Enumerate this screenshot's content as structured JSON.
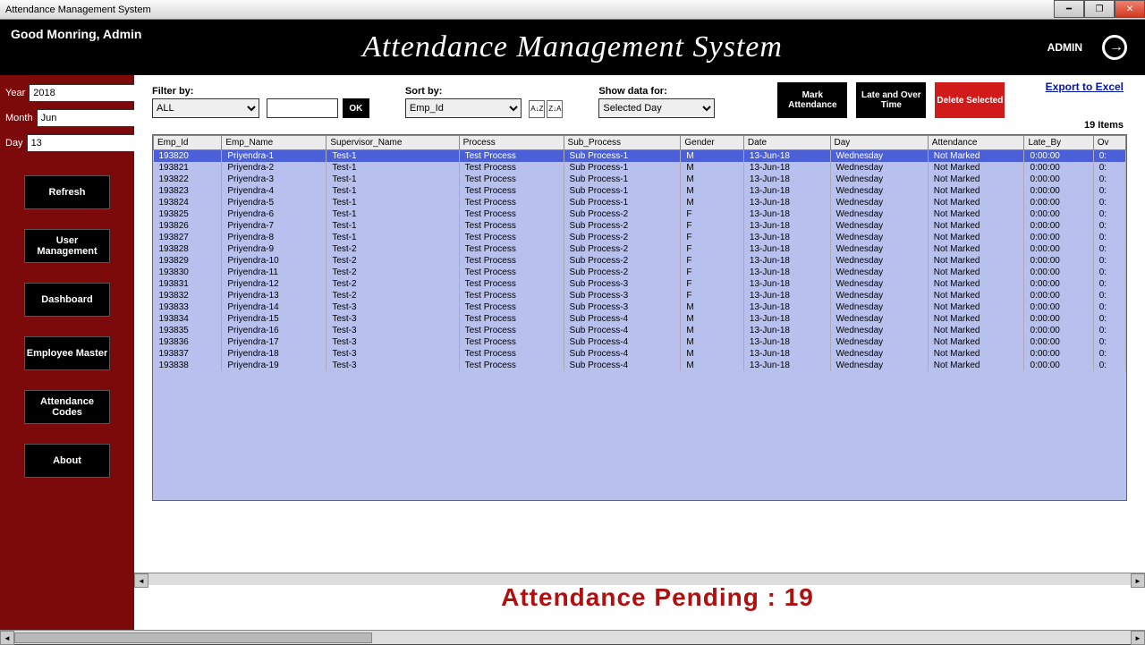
{
  "window_title": "Attendance Management System",
  "header": {
    "greeting": "Good Monring, Admin",
    "title": "Attendance Management System",
    "user_role": "ADMIN"
  },
  "sidebar": {
    "year_label": "Year",
    "year_value": "2018",
    "month_label": "Month",
    "month_value": "Jun",
    "day_label": "Day",
    "day_value": "13",
    "buttons": [
      "Refresh",
      "User Management",
      "Dashboard",
      "Employee Master",
      "Attendance Codes",
      "About"
    ]
  },
  "toolbar": {
    "filter_label": "Filter by:",
    "filter_value": "ALL",
    "filter_text": "",
    "ok": "OK",
    "sort_label": "Sort by:",
    "sort_value": "Emp_Id",
    "show_label": "Show data for:",
    "show_value": "Selected Day",
    "mark": "Mark Attendance",
    "late": "Late and Over Time",
    "delete": "Delete Selected",
    "export": "Export to Excel",
    "items_count": "19 Items"
  },
  "columns": [
    "Emp_Id",
    "Emp_Name",
    "Supervisor_Name",
    "Process",
    "Sub_Process",
    "Gender",
    "Date",
    "Day",
    "Attendance",
    "Late_By",
    "Ov"
  ],
  "rows": [
    {
      "id": "193820",
      "name": "Priyendra-1",
      "sup": "Test-1",
      "proc": "Test Process",
      "sub": "Sub Process-1",
      "g": "M",
      "date": "13-Jun-18",
      "day": "Wednesday",
      "att": "Not Marked",
      "late": "0:00:00",
      "ov": "0:"
    },
    {
      "id": "193821",
      "name": "Priyendra-2",
      "sup": "Test-1",
      "proc": "Test Process",
      "sub": "Sub Process-1",
      "g": "M",
      "date": "13-Jun-18",
      "day": "Wednesday",
      "att": "Not Marked",
      "late": "0:00:00",
      "ov": "0:"
    },
    {
      "id": "193822",
      "name": "Priyendra-3",
      "sup": "Test-1",
      "proc": "Test Process",
      "sub": "Sub Process-1",
      "g": "M",
      "date": "13-Jun-18",
      "day": "Wednesday",
      "att": "Not Marked",
      "late": "0:00:00",
      "ov": "0:"
    },
    {
      "id": "193823",
      "name": "Priyendra-4",
      "sup": "Test-1",
      "proc": "Test Process",
      "sub": "Sub Process-1",
      "g": "M",
      "date": "13-Jun-18",
      "day": "Wednesday",
      "att": "Not Marked",
      "late": "0:00:00",
      "ov": "0:"
    },
    {
      "id": "193824",
      "name": "Priyendra-5",
      "sup": "Test-1",
      "proc": "Test Process",
      "sub": "Sub Process-1",
      "g": "M",
      "date": "13-Jun-18",
      "day": "Wednesday",
      "att": "Not Marked",
      "late": "0:00:00",
      "ov": "0:"
    },
    {
      "id": "193825",
      "name": "Priyendra-6",
      "sup": "Test-1",
      "proc": "Test Process",
      "sub": "Sub Process-2",
      "g": "F",
      "date": "13-Jun-18",
      "day": "Wednesday",
      "att": "Not Marked",
      "late": "0:00:00",
      "ov": "0:"
    },
    {
      "id": "193826",
      "name": "Priyendra-7",
      "sup": "Test-1",
      "proc": "Test Process",
      "sub": "Sub Process-2",
      "g": "F",
      "date": "13-Jun-18",
      "day": "Wednesday",
      "att": "Not Marked",
      "late": "0:00:00",
      "ov": "0:"
    },
    {
      "id": "193827",
      "name": "Priyendra-8",
      "sup": "Test-1",
      "proc": "Test Process",
      "sub": "Sub Process-2",
      "g": "F",
      "date": "13-Jun-18",
      "day": "Wednesday",
      "att": "Not Marked",
      "late": "0:00:00",
      "ov": "0:"
    },
    {
      "id": "193828",
      "name": "Priyendra-9",
      "sup": "Test-2",
      "proc": "Test Process",
      "sub": "Sub Process-2",
      "g": "F",
      "date": "13-Jun-18",
      "day": "Wednesday",
      "att": "Not Marked",
      "late": "0:00:00",
      "ov": "0:"
    },
    {
      "id": "193829",
      "name": "Priyendra-10",
      "sup": "Test-2",
      "proc": "Test Process",
      "sub": "Sub Process-2",
      "g": "F",
      "date": "13-Jun-18",
      "day": "Wednesday",
      "att": "Not Marked",
      "late": "0:00:00",
      "ov": "0:"
    },
    {
      "id": "193830",
      "name": "Priyendra-11",
      "sup": "Test-2",
      "proc": "Test Process",
      "sub": "Sub Process-2",
      "g": "F",
      "date": "13-Jun-18",
      "day": "Wednesday",
      "att": "Not Marked",
      "late": "0:00:00",
      "ov": "0:"
    },
    {
      "id": "193831",
      "name": "Priyendra-12",
      "sup": "Test-2",
      "proc": "Test Process",
      "sub": "Sub Process-3",
      "g": "F",
      "date": "13-Jun-18",
      "day": "Wednesday",
      "att": "Not Marked",
      "late": "0:00:00",
      "ov": "0:"
    },
    {
      "id": "193832",
      "name": "Priyendra-13",
      "sup": "Test-2",
      "proc": "Test Process",
      "sub": "Sub Process-3",
      "g": "F",
      "date": "13-Jun-18",
      "day": "Wednesday",
      "att": "Not Marked",
      "late": "0:00:00",
      "ov": "0:"
    },
    {
      "id": "193833",
      "name": "Priyendra-14",
      "sup": "Test-3",
      "proc": "Test Process",
      "sub": "Sub Process-3",
      "g": "M",
      "date": "13-Jun-18",
      "day": "Wednesday",
      "att": "Not Marked",
      "late": "0:00:00",
      "ov": "0:"
    },
    {
      "id": "193834",
      "name": "Priyendra-15",
      "sup": "Test-3",
      "proc": "Test Process",
      "sub": "Sub Process-4",
      "g": "M",
      "date": "13-Jun-18",
      "day": "Wednesday",
      "att": "Not Marked",
      "late": "0:00:00",
      "ov": "0:"
    },
    {
      "id": "193835",
      "name": "Priyendra-16",
      "sup": "Test-3",
      "proc": "Test Process",
      "sub": "Sub Process-4",
      "g": "M",
      "date": "13-Jun-18",
      "day": "Wednesday",
      "att": "Not Marked",
      "late": "0:00:00",
      "ov": "0:"
    },
    {
      "id": "193836",
      "name": "Priyendra-17",
      "sup": "Test-3",
      "proc": "Test Process",
      "sub": "Sub Process-4",
      "g": "M",
      "date": "13-Jun-18",
      "day": "Wednesday",
      "att": "Not Marked",
      "late": "0:00:00",
      "ov": "0:"
    },
    {
      "id": "193837",
      "name": "Priyendra-18",
      "sup": "Test-3",
      "proc": "Test Process",
      "sub": "Sub Process-4",
      "g": "M",
      "date": "13-Jun-18",
      "day": "Wednesday",
      "att": "Not Marked",
      "late": "0:00:00",
      "ov": "0:"
    },
    {
      "id": "193838",
      "name": "Priyendra-19",
      "sup": "Test-3",
      "proc": "Test Process",
      "sub": "Sub Process-4",
      "g": "M",
      "date": "13-Jun-18",
      "day": "Wednesday",
      "att": "Not Marked",
      "late": "0:00:00",
      "ov": "0:"
    }
  ],
  "footer": "Attendance Pending : 19"
}
